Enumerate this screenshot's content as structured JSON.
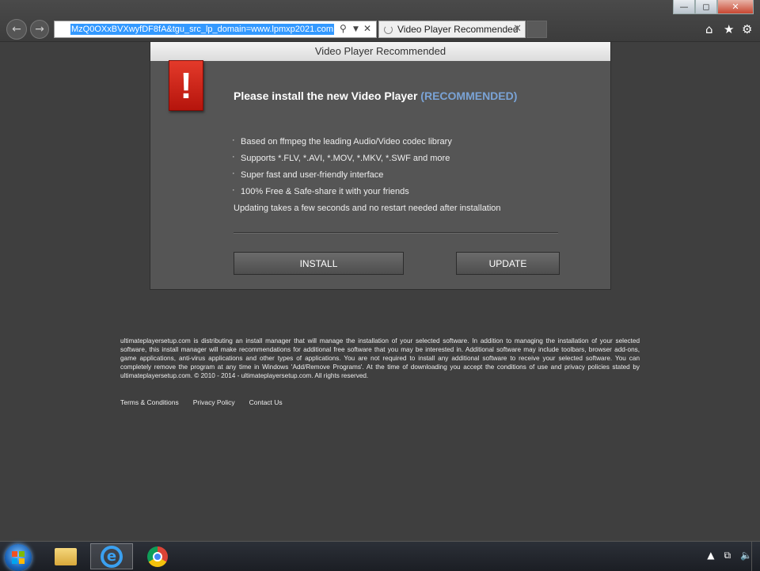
{
  "browser": {
    "url": "MzQ0OXxBVXwyfDF8fA&tgu_src_lp_domain=www.lpmxp2021.com",
    "tab_title": "Video Player Recommended",
    "icons": {
      "back": "back-arrow-icon",
      "forward": "forward-arrow-icon",
      "search": "search-icon",
      "dropdown": "dropdown-icon",
      "stop": "stop-icon",
      "home": "home-icon",
      "favorites": "star-icon",
      "tools": "gear-icon"
    },
    "window_controls": {
      "minimize": "—",
      "maximize": "◻",
      "close": "✕"
    }
  },
  "dialog": {
    "title": "Video Player Recommended",
    "headline": "Please install the new Video Player",
    "headline_highlight": "(RECOMMENDED)",
    "alert_glyph": "!",
    "features": [
      "Based on ffmpeg the leading Audio/Video codec library",
      "Supports *.FLV, *.AVI, *.MOV, *.MKV, *.SWF and more",
      "Super fast and user-friendly interface",
      "100% Free & Safe-share it with your friends"
    ],
    "note": "Updating takes a few seconds and no restart needed after installation",
    "install_label": "INSTALL",
    "update_label": "UPDATE",
    "colors": {
      "highlight": "#7aa3d6",
      "alert": "#d42a1c"
    }
  },
  "disclaimer": {
    "text": "ultimateplayersetup.com is distributing an install manager that will manage the installation of your selected software. In addition to managing the installation of your selected software, this install manager will make recommendations for additional free software that you may be interested in. Additional software may include toolbars, browser add-ons, game applications, anti-virus applications and other types of applications. You are not required to install any additional software to receive your selected software. You can completely remove the program at any time in Windows 'Add/Remove Programs'. At the time of downloading you accept the conditions of use and privacy policies stated by ultimateplayersetup.com. © 2010 - 2014 - ultimateplayersetup.com. All rights reserved.",
    "links": [
      "Terms & Conditions",
      "Privacy Policy",
      "Contact Us"
    ]
  },
  "taskbar": {
    "items": [
      "windows-explorer",
      "internet-explorer",
      "google-chrome"
    ],
    "tray": {
      "show_hidden": "▲",
      "network": "⧉",
      "volume": "🔈"
    }
  }
}
